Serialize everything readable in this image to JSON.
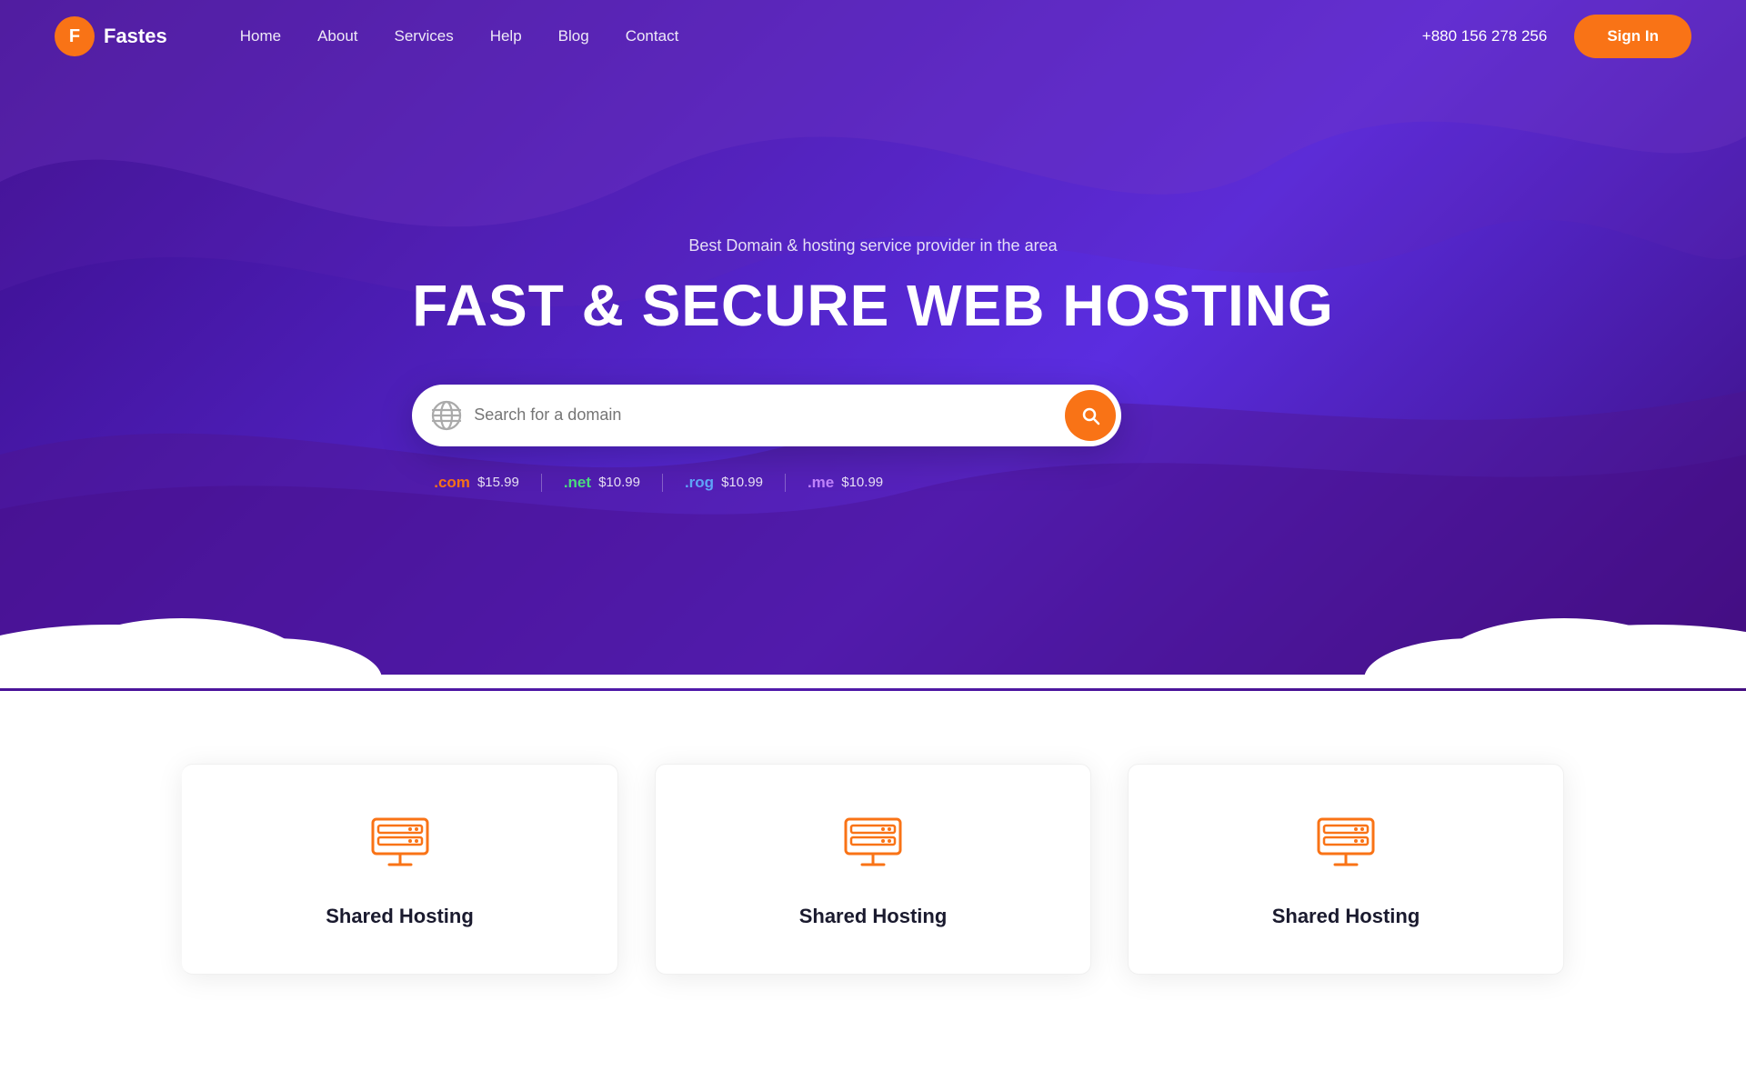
{
  "brand": {
    "name": "Fastes",
    "logo_letter": "F"
  },
  "navbar": {
    "links": [
      {
        "label": "Home",
        "id": "home"
      },
      {
        "label": "About",
        "id": "about"
      },
      {
        "label": "Services",
        "id": "services"
      },
      {
        "label": "Help",
        "id": "help"
      },
      {
        "label": "Blog",
        "id": "blog"
      },
      {
        "label": "Contact",
        "id": "contact"
      }
    ],
    "phone": "+880 156 278 256",
    "sign_in_label": "Sign In"
  },
  "hero": {
    "subtitle": "Best Domain & hosting service provider in the area",
    "title": "FAST & SECURE WEB HOSTING",
    "search_placeholder": "Search for a domain",
    "domain_prices": [
      {
        "ext": ".com",
        "price": "$15.99",
        "class": "com"
      },
      {
        "ext": ".net",
        "price": "$10.99",
        "class": "net"
      },
      {
        "ext": ".rog",
        "price": "$10.99",
        "class": "rog"
      },
      {
        "ext": ".me",
        "price": "$10.99",
        "class": "me"
      }
    ]
  },
  "cards": [
    {
      "title": "Shared Hosting",
      "id": "card-1"
    },
    {
      "title": "Shared Hosting",
      "id": "card-2"
    },
    {
      "title": "Shared Hosting",
      "id": "card-3"
    }
  ],
  "colors": {
    "accent": "#f97316",
    "hero_bg_start": "#3b0d8a",
    "hero_bg_end": "#4c1db5"
  }
}
